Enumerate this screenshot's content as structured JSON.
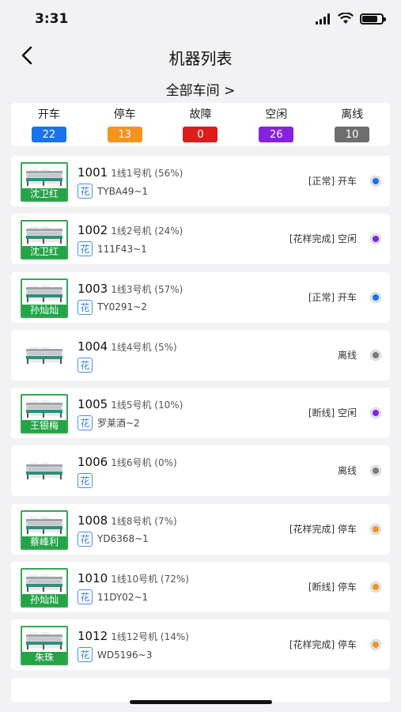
{
  "status_bar": {
    "time": "3:31",
    "battery_level": 0.8
  },
  "nav": {
    "title": "机器列表",
    "back_icon": "chevron-left-icon"
  },
  "workshop_filter": {
    "label": "全部车间 >"
  },
  "summary": [
    {
      "label": "开车",
      "count": "22",
      "color": "#1a73e8"
    },
    {
      "label": "停车",
      "count": "13",
      "color": "#f5931e"
    },
    {
      "label": "故障",
      "count": "0",
      "color": "#dd1c1c"
    },
    {
      "label": "空闲",
      "count": "26",
      "color": "#8422e0"
    },
    {
      "label": "离线",
      "count": "10",
      "color": "#6e6e6e"
    }
  ],
  "machines": [
    {
      "id": "1001",
      "desc": "1线1号机 (56%)",
      "flower": "花",
      "pattern": "TYBA49~1",
      "operator": "沈卫红",
      "status": "[正常] 开车",
      "dot_color": "#1a73e8"
    },
    {
      "id": "1002",
      "desc": "1线2号机 (24%)",
      "flower": "花",
      "pattern": "111F43~1",
      "operator": "沈卫红",
      "status": "[花样完成] 空闲",
      "dot_color": "#8422e0"
    },
    {
      "id": "1003",
      "desc": "1线3号机 (57%)",
      "flower": "花",
      "pattern": "TY0291~2",
      "operator": "孙灿灿",
      "status": "[正常] 开车",
      "dot_color": "#1a73e8"
    },
    {
      "id": "1004",
      "desc": "1线4号机 (5%)",
      "flower": "花",
      "pattern": "",
      "operator": "",
      "status": "离线",
      "dot_color": "#7a7a7a"
    },
    {
      "id": "1005",
      "desc": "1线5号机 (10%)",
      "flower": "花",
      "pattern": "罗莱酒~2",
      "operator": "王银梅",
      "status": "[断线] 空闲",
      "dot_color": "#8422e0"
    },
    {
      "id": "1006",
      "desc": "1线6号机 (0%)",
      "flower": "花",
      "pattern": "",
      "operator": "",
      "status": "离线",
      "dot_color": "#7a7a7a"
    },
    {
      "id": "1008",
      "desc": "1线8号机 (7%)",
      "flower": "花",
      "pattern": "YD6368~1",
      "operator": "蔡峰利",
      "status": "[花样完成] 停车",
      "dot_color": "#f5931e"
    },
    {
      "id": "1010",
      "desc": "1线10号机 (72%)",
      "flower": "花",
      "pattern": "11DY02~1",
      "operator": "孙灿灿",
      "status": "[断线] 停车",
      "dot_color": "#f5931e"
    },
    {
      "id": "1012",
      "desc": "1线12号机 (14%)",
      "flower": "花",
      "pattern": "WD5196~3",
      "operator": "朱珠",
      "status": "[花样完成] 停车",
      "dot_color": "#f5931e"
    }
  ]
}
